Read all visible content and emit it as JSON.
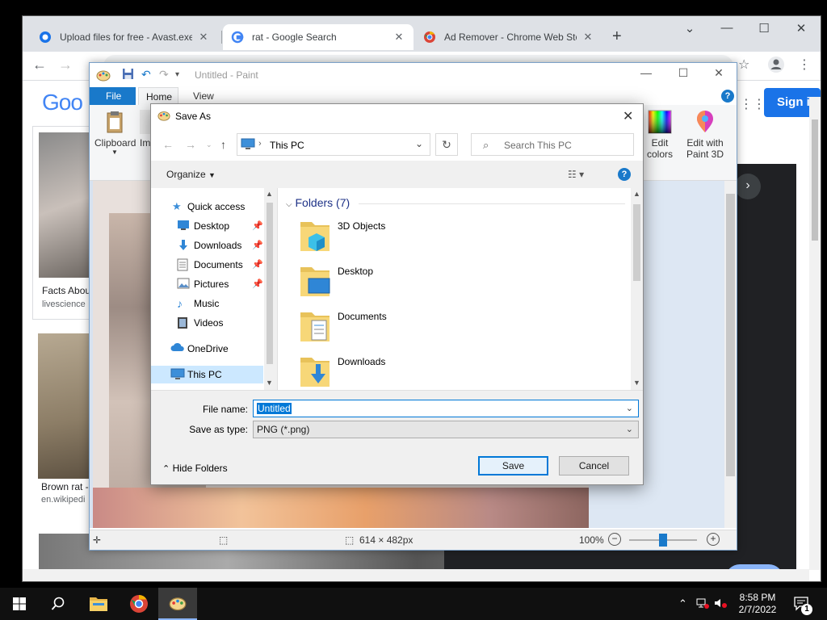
{
  "chrome": {
    "tabs": [
      {
        "title": "Upload files for free - Avast.exe -",
        "close": "✕"
      },
      {
        "title": "rat - Google Search",
        "close": "✕"
      },
      {
        "title": "Ad Remover - Chrome Web Stor",
        "close": "✕"
      }
    ],
    "new_tab": "+",
    "controls": {
      "min": "—",
      "max": "☐",
      "close": "✕"
    },
    "sign_in": "Sign i",
    "google_logo": "Goo",
    "results": [
      {
        "caption": "Facts Abou",
        "source": "livescience"
      },
      {
        "caption": "Brown rat -",
        "source": "en.wikipedi"
      }
    ],
    "visit_button": "sit"
  },
  "paint": {
    "title": "Untitled - Paint",
    "tabs": {
      "file": "File",
      "home": "Home",
      "view": "View"
    },
    "ribbon": {
      "clipboard": "Clipboard",
      "image_partial": "Im",
      "edit_colors_line1": "Edit",
      "edit_colors_line2": "colors",
      "paint3d_line1": "Edit with",
      "paint3d_line2": "Paint 3D"
    },
    "status": {
      "dimensions": "614 × 482px",
      "zoom": "100%"
    }
  },
  "dialog": {
    "title": "Save As",
    "address": "This PC",
    "search_placeholder": "Search This PC",
    "organize": "Organize",
    "nav": {
      "quick_access": "Quick access",
      "desktop": "Desktop",
      "downloads": "Downloads",
      "documents": "Documents",
      "pictures": "Pictures",
      "music": "Music",
      "videos": "Videos",
      "onedrive": "OneDrive",
      "this_pc": "This PC"
    },
    "folders_header": "Folders (7)",
    "folders": [
      "3D Objects",
      "Desktop",
      "Documents",
      "Downloads"
    ],
    "file_name_label": "File name:",
    "file_name_value": "Untitled",
    "save_as_type_label": "Save as type:",
    "save_as_type_value": "PNG (*.png)",
    "hide_folders": "Hide Folders",
    "save": "Save",
    "cancel": "Cancel"
  },
  "taskbar": {
    "time": "8:58 PM",
    "date": "2/7/2022",
    "notifications": "1"
  },
  "colors": {
    "accent": "#0078d7",
    "paint_file_tab": "#1979ca",
    "chrome_tabstrip": "#dee1e6"
  }
}
